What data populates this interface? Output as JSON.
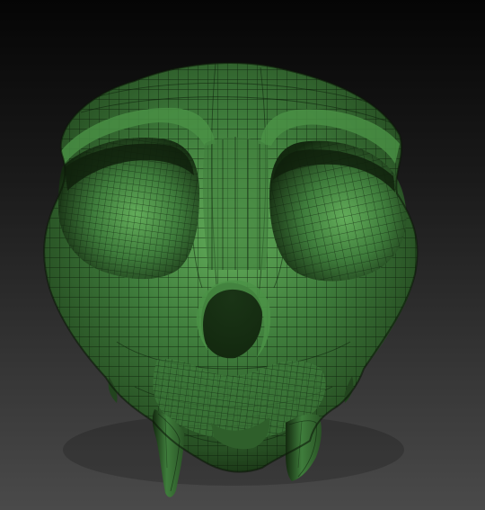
{
  "viewport": {
    "subject": "skull-mesh",
    "background": {
      "top": "#050505",
      "bottom": "#4a4a4a"
    },
    "mesh": {
      "base_color": "#3f7d3c",
      "highlight_color": "#63ad5a",
      "shadow_color": "#13290f",
      "wire_color": "#0d1f0b",
      "wireframe": true
    }
  }
}
